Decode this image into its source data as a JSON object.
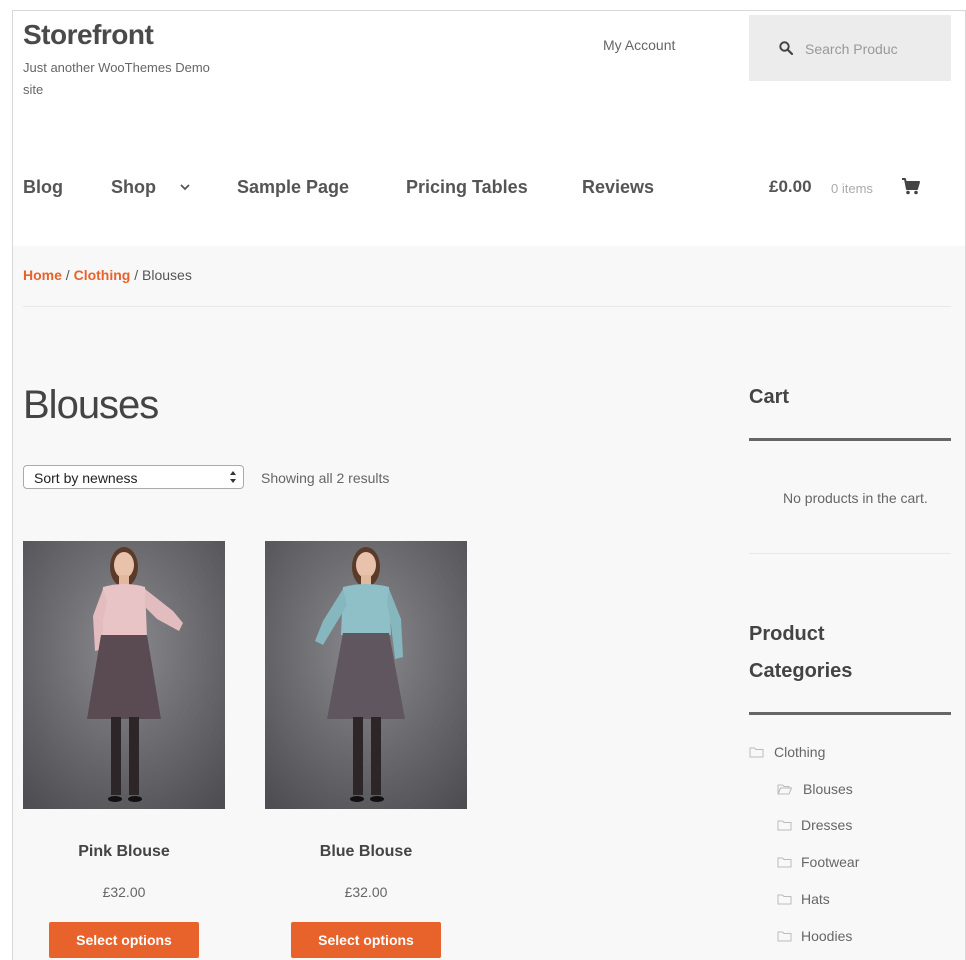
{
  "header": {
    "site_title": "Storefront",
    "site_description": "Just another WooThemes Demo site",
    "my_account": "My Account",
    "search": {
      "placeholder": "Search Produc"
    }
  },
  "nav": {
    "items": [
      "Blog",
      "Shop",
      "Sample Page",
      "Pricing Tables",
      "Reviews"
    ]
  },
  "header_cart": {
    "amount": "£0.00",
    "items": "0 items"
  },
  "breadcrumb": {
    "home": "Home",
    "sep1": " / ",
    "category": "Clothing",
    "sep2": " / ",
    "current": "Blouses"
  },
  "main": {
    "title": "Blouses",
    "sort_selected": "Sort by newness",
    "result_count": "Showing all 2 results",
    "products": [
      {
        "name": "Pink Blouse",
        "price": "£32.00",
        "button": "Select options"
      },
      {
        "name": "Blue Blouse",
        "price": "£32.00",
        "button": "Select options"
      }
    ]
  },
  "sidebar": {
    "cart_title": "Cart",
    "cart_empty": "No products in the cart.",
    "categories_title": "Product Categories",
    "categories": [
      "Clothing",
      "Blouses",
      "Dresses",
      "Footwear",
      "Hats",
      "Hoodies"
    ]
  },
  "colors": {
    "accent": "#e8622b",
    "text": "#444444",
    "pink_blouse": "#e8c4c6",
    "blue_blouse": "#8fbfc7",
    "skirt": "#5a4a52"
  },
  "icons": [
    "search-icon",
    "chevron-down-icon",
    "cart-icon",
    "sort-arrows-icon",
    "folder-icon",
    "folder-open-icon"
  ]
}
